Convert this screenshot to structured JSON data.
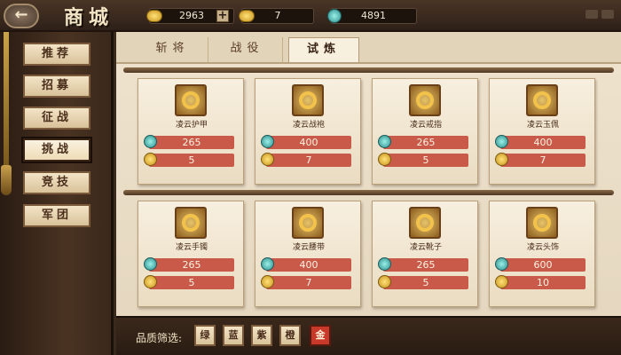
{
  "header": {
    "title": "商城",
    "back_icon": "back-arrow-icon",
    "resources": [
      {
        "type": "silver",
        "value": "2963"
      },
      {
        "type": "gold",
        "value": "7"
      },
      {
        "type": "jade",
        "value": "4891"
      }
    ],
    "plus_label": "+"
  },
  "sidebar": {
    "items": [
      {
        "label": "推荐",
        "active": false
      },
      {
        "label": "招募",
        "active": false
      },
      {
        "label": "征战",
        "active": false
      },
      {
        "label": "挑战",
        "active": true
      },
      {
        "label": "竞技",
        "active": false
      },
      {
        "label": "军团",
        "active": false
      }
    ]
  },
  "tabs": [
    {
      "label": "斩将",
      "active": false
    },
    {
      "label": "战役",
      "active": false
    },
    {
      "label": "试炼",
      "active": true
    }
  ],
  "items": [
    {
      "name": "凌云护甲",
      "jade_price": "265",
      "gold_price": "5"
    },
    {
      "name": "凌云战袍",
      "jade_price": "400",
      "gold_price": "7"
    },
    {
      "name": "凌云戒指",
      "jade_price": "265",
      "gold_price": "5"
    },
    {
      "name": "凌云玉佩",
      "jade_price": "400",
      "gold_price": "7"
    },
    {
      "name": "凌云手镯",
      "jade_price": "265",
      "gold_price": "5"
    },
    {
      "name": "凌云腰带",
      "jade_price": "400",
      "gold_price": "7"
    },
    {
      "name": "凌云靴子",
      "jade_price": "265",
      "gold_price": "5"
    },
    {
      "name": "凌云头饰",
      "jade_price": "600",
      "gold_price": "10"
    }
  ],
  "filter": {
    "label": "品质筛选:",
    "options": [
      {
        "label": "绿",
        "active": false
      },
      {
        "label": "蓝",
        "active": false
      },
      {
        "label": "紫",
        "active": false
      },
      {
        "label": "橙",
        "active": false
      },
      {
        "label": "金",
        "active": true
      }
    ]
  },
  "colors": {
    "accent_red": "#c95a4a",
    "panel_bg": "#efe3cf",
    "frame_dark": "#3a281b"
  }
}
